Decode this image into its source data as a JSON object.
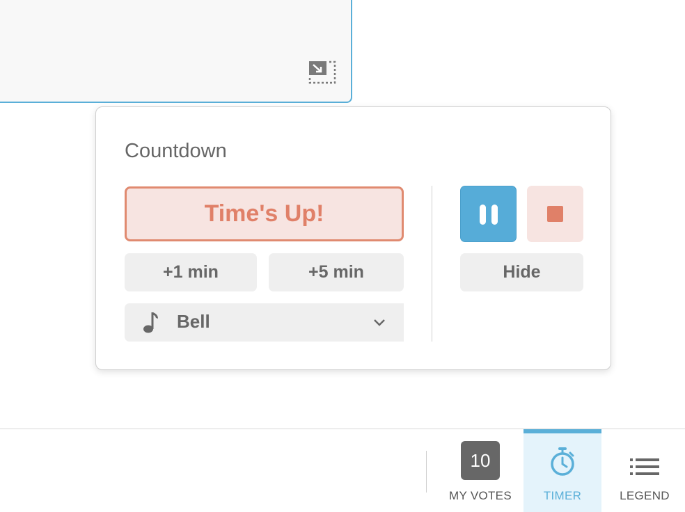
{
  "countdown": {
    "title": "Countdown",
    "status_label": "Time's Up!",
    "add_1_label": "+1 min",
    "add_5_label": "+5 min",
    "sound": {
      "selected": "Bell"
    },
    "hide_label": "Hide"
  },
  "toolbar": {
    "votes_count": "10",
    "votes_label": "MY VOTES",
    "timer_label": "TIMER",
    "legend_label": "LEGEND"
  },
  "colors": {
    "accent_blue": "#5aafd8",
    "alert_red": "#e08068",
    "alert_bg": "#f7e4e1"
  },
  "icons": [
    "resize-icon",
    "music-note-icon",
    "chevron-down-icon",
    "pause-icon",
    "stop-icon",
    "stopwatch-icon",
    "list-icon"
  ]
}
